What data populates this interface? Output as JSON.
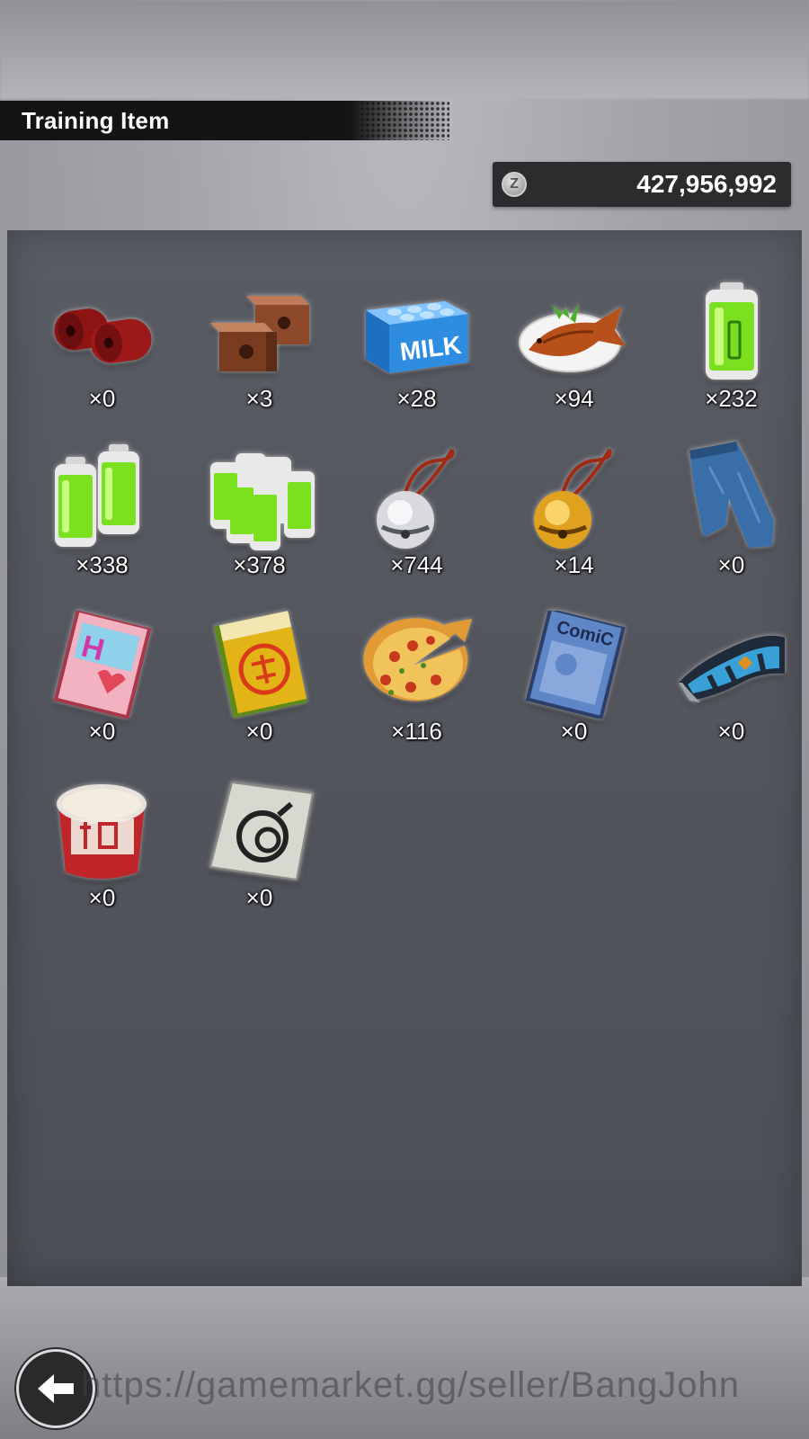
{
  "header": {
    "title": "Training Item"
  },
  "currency": {
    "icon": "coin-icon",
    "glyph": "Z",
    "amount": "427,956,992"
  },
  "items": [
    {
      "icon": "red-weights-icon",
      "count": "×0"
    },
    {
      "icon": "copper-bricks-icon",
      "count": "×3"
    },
    {
      "icon": "milk-carton-icon",
      "count": "×28"
    },
    {
      "icon": "grilled-fish-icon",
      "count": "×94"
    },
    {
      "icon": "green-battery-icon",
      "count": "×232"
    },
    {
      "icon": "double-battery-icon",
      "count": "×338"
    },
    {
      "icon": "battery-pack-icon",
      "count": "×378"
    },
    {
      "icon": "silver-bell-icon",
      "count": "×744"
    },
    {
      "icon": "gold-bell-icon",
      "count": "×14"
    },
    {
      "icon": "jeans-icon",
      "count": "×0"
    },
    {
      "icon": "pink-magazine-icon",
      "count": "×0"
    },
    {
      "icon": "joke-book-icon",
      "count": "×0"
    },
    {
      "icon": "pizza-icon",
      "count": "×116"
    },
    {
      "icon": "comic-magazine-icon",
      "count": "×0"
    },
    {
      "icon": "wristband-icon",
      "count": "×0"
    },
    {
      "icon": "cup-noodle-icon",
      "count": "×0"
    },
    {
      "icon": "seal-card-icon",
      "count": "×0"
    }
  ],
  "navigation": {
    "back_icon": "back-arrow-icon"
  },
  "watermark": "https://gamemarket.gg/seller/BangJohn",
  "colors": {
    "panel": "#52545c",
    "banner": "#141414",
    "battery": "#7be01f",
    "milk": "#2f8de0"
  }
}
